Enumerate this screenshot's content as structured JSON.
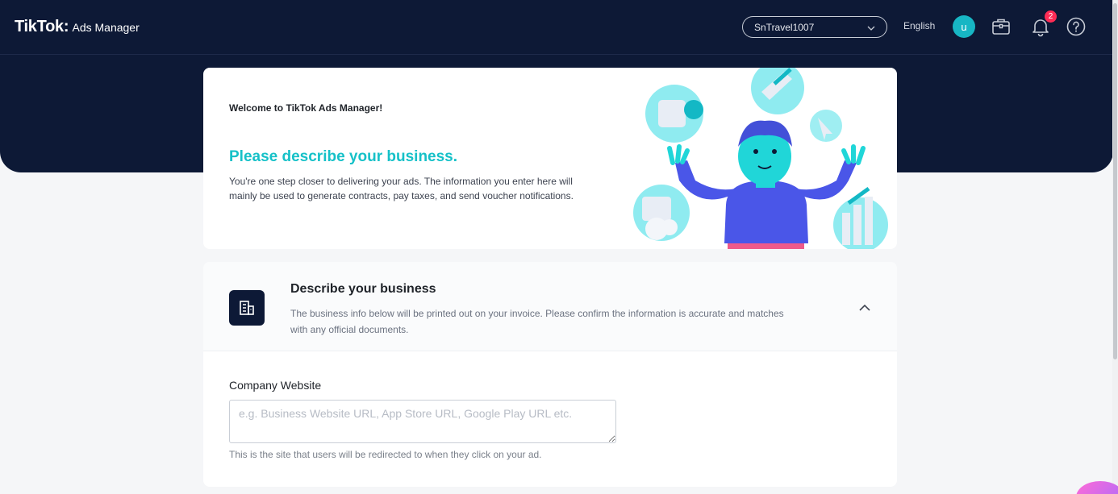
{
  "header": {
    "brand": "TikTok",
    "brand_colon": ":",
    "product": "Ads Manager",
    "account": "SnTravel1007",
    "language": "English",
    "avatar_initial": "u",
    "notification_count": "2",
    "icons": [
      "briefcase-icon",
      "bell-icon",
      "help-icon",
      "chevron-down-icon"
    ]
  },
  "welcome": {
    "title": "Welcome to TikTok Ads Manager!",
    "heading": "Please describe your business.",
    "description": "You're one step closer to delivering your ads. The information you enter here will mainly be used to generate contracts, pay taxes, and send voucher notifications."
  },
  "business": {
    "title": "Describe your business",
    "description": "The business info below will be printed out on your invoice. Please confirm the information is accurate and matches with any official documents.",
    "website_label": "Company Website",
    "website_placeholder": "e.g. Business Website URL, App Store URL, Google Play URL etc.",
    "website_value": "",
    "website_help": "This is the site that users will be redirected to when they click on your ad."
  },
  "colors": {
    "nav_bg": "#0d1936",
    "accent": "#16c1c8",
    "badge": "#fe2c55"
  }
}
